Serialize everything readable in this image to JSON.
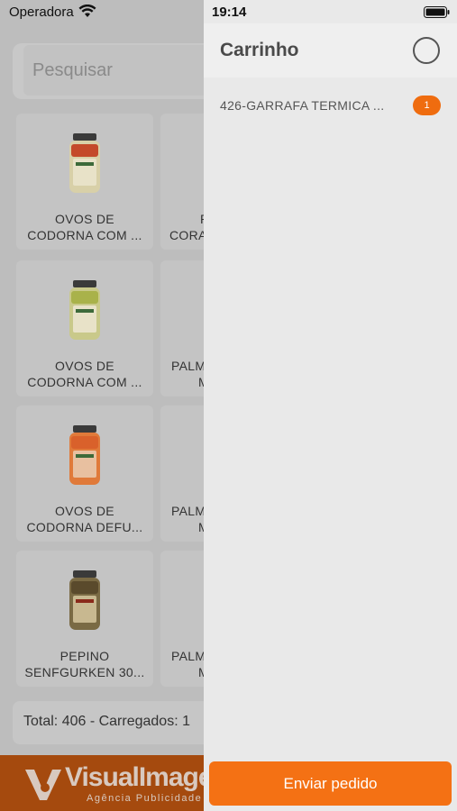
{
  "status_bar": {
    "carrier": "Operadora",
    "time": "19:14"
  },
  "search": {
    "placeholder": "Pesquisar"
  },
  "products": [
    {
      "name_line1": "OVOS DE",
      "name_line2": "CODORNA COM ...",
      "jar_color": "#c44a2a"
    },
    {
      "name_line1": "P",
      "name_line2": "CORA",
      "jar_color": "#cfcfcf"
    },
    {
      "name_line1": "OVOS DE",
      "name_line2": "CODORNA COM ...",
      "jar_color": "#a9b24a"
    },
    {
      "name_line1": "PALM",
      "name_line2": "M",
      "jar_color": "#cfcfcf"
    },
    {
      "name_line1": "OVOS DE",
      "name_line2": "CODORNA DEFU...",
      "jar_color": "#d9612b"
    },
    {
      "name_line1": "PALM",
      "name_line2": "M",
      "jar_color": "#cfcfcf"
    },
    {
      "name_line1": "PEPINO",
      "name_line2": "SENFGURKEN 30...",
      "jar_color": "#5a4a2c"
    },
    {
      "name_line1": "PALM",
      "name_line2": "M",
      "jar_color": "#cfcfcf"
    }
  ],
  "footer": {
    "info": "Total: 406 - Carregados: 1"
  },
  "brand": {
    "name": "VisualImagen",
    "subtitle": "Agência Publicidade"
  },
  "cart": {
    "title": "Carrinho",
    "items": [
      {
        "name": "426-GARRAFA TERMICA ...",
        "qty": "1"
      }
    ],
    "send_label": "Enviar pedido"
  },
  "colors": {
    "accent": "#f47114",
    "badge": "#ef6c0f",
    "brand_bar": "#a54a0e"
  }
}
